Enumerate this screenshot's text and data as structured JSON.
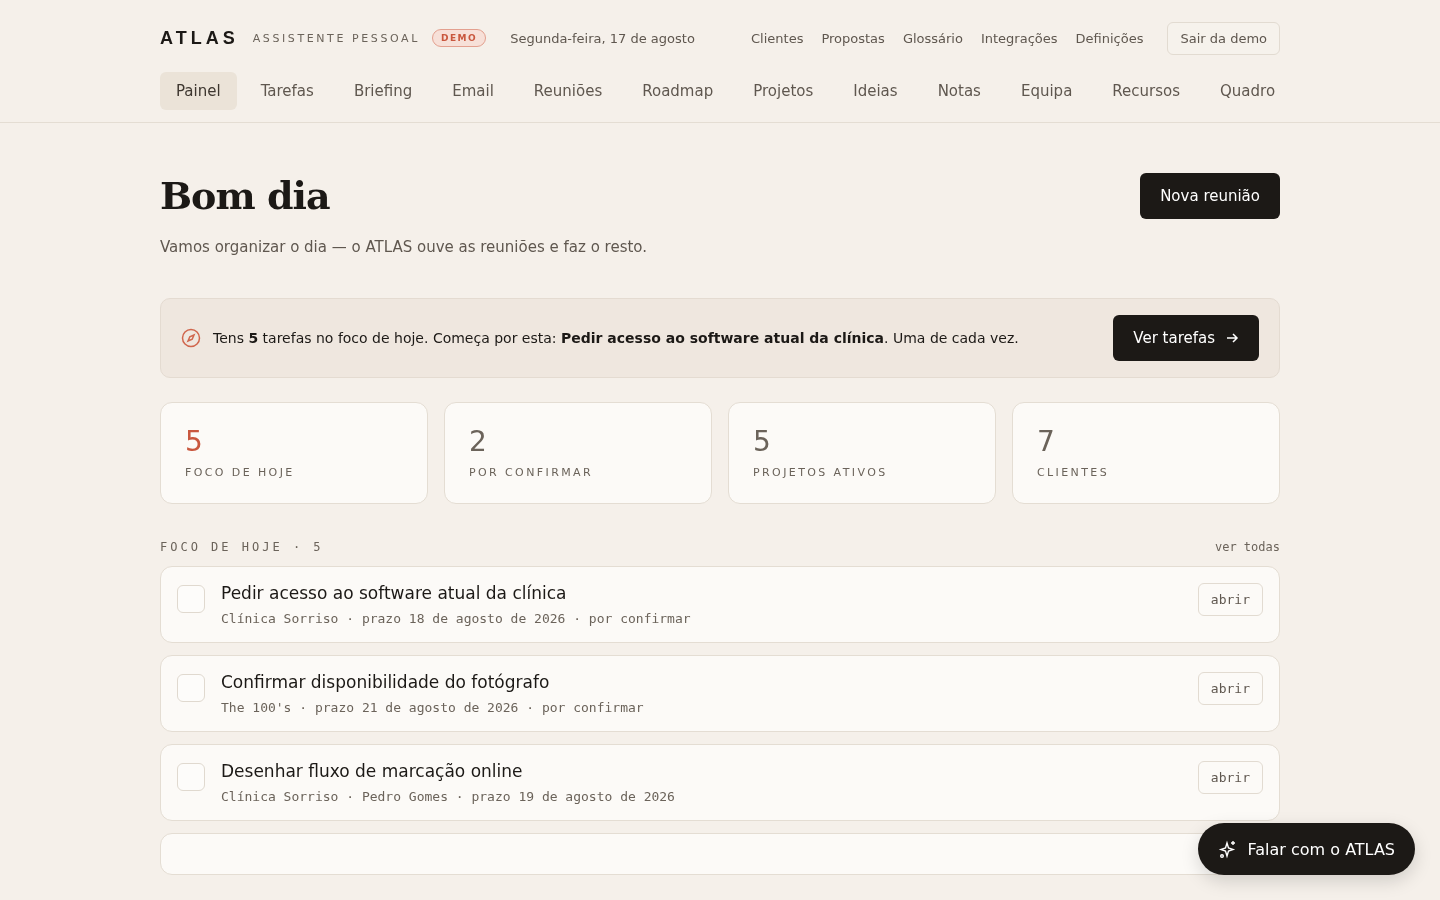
{
  "brand": {
    "name": "ATLAS",
    "subtitle": "ASSISTENTE PESSOAL",
    "badge": "DEMO"
  },
  "date": "Segunda-feira, 17 de agosto",
  "top_links": [
    "Clientes",
    "Propostas",
    "Glossário",
    "Integrações",
    "Definições"
  ],
  "exit_button": "Sair da demo",
  "tabs": [
    {
      "label": "Painel",
      "selected": true
    },
    {
      "label": "Tarefas",
      "selected": false
    },
    {
      "label": "Briefing",
      "selected": false
    },
    {
      "label": "Email",
      "selected": false
    },
    {
      "label": "Reuniões",
      "selected": false
    },
    {
      "label": "Roadmap",
      "selected": false
    },
    {
      "label": "Projetos",
      "selected": false
    },
    {
      "label": "Ideias",
      "selected": false
    },
    {
      "label": "Notas",
      "selected": false
    },
    {
      "label": "Equipa",
      "selected": false
    },
    {
      "label": "Recursos",
      "selected": false
    },
    {
      "label": "Quadro",
      "selected": false
    }
  ],
  "heading": "Bom dia",
  "subheading": "Vamos organizar o dia — o ATLAS ouve as reuniões e faz o resto.",
  "new_meeting_button": "Nova reunião",
  "focus_banner": {
    "text": "Tens **5** tarefas no foco de hoje. Começa por esta: **Pedir acesso ao software atual da clínica**. Uma de cada vez.",
    "button": "Ver tarefas"
  },
  "stats": [
    {
      "value": "5",
      "label": "FOCO DE HOJE",
      "highlighted": true
    },
    {
      "value": "2",
      "label": "POR CONFIRMAR",
      "highlighted": false
    },
    {
      "value": "5",
      "label": "PROJETOS ATIVOS",
      "highlighted": false
    },
    {
      "value": "7",
      "label": "CLIENTES",
      "highlighted": false
    }
  ],
  "section": {
    "title": "FOCO DE HOJE · 5",
    "link": "ver todas"
  },
  "tasks": [
    {
      "title": "Pedir acesso ao software atual da clínica",
      "meta": "Clínica Sorriso · prazo 18 de agosto de 2026 · por confirmar",
      "checked": false,
      "button": "abrir"
    },
    {
      "title": "Confirmar disponibilidade do fotógrafo",
      "meta": "The 100's · prazo 21 de agosto de 2026 · por confirmar",
      "checked": false,
      "button": "abrir"
    },
    {
      "title": "Desenhar fluxo de marcação online",
      "meta": "Clínica Sorriso · Pedro Gomes · prazo 19 de agosto de 2026",
      "checked": false,
      "button": "abrir"
    }
  ],
  "chat_button": "Falar com o ATLAS"
}
